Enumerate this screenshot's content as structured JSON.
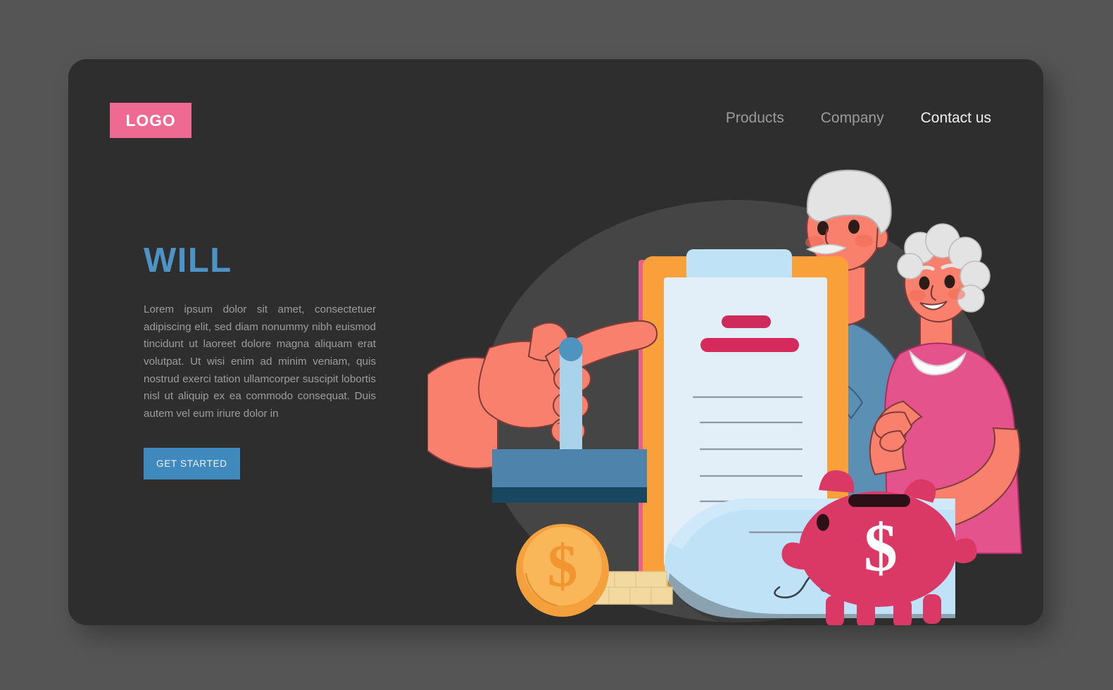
{
  "page": {
    "background_color": "#555555",
    "card_color": "#2e2e2e"
  },
  "header": {
    "logo_text": "LOGO",
    "logo_color": "#ef6a93",
    "nav_items": [
      {
        "label": "Products",
        "active": false
      },
      {
        "label": "Company",
        "active": false
      },
      {
        "label": "Contact us",
        "active": true
      }
    ]
  },
  "hero": {
    "title": "WILL",
    "title_color": "#4e93c6",
    "body": "Lorem ipsum dolor sit amet, consectetuer adipiscing elit, sed diam nonummy nibh euismod tincidunt ut laoreet dolore magna aliquam erat volutpat. Ut wisi enim ad minim veniam, quis nostrud exerci tation ullamcorper suscipit lobortis nisl ut aliquip ex ea commodo consequat. Duis autem vel eum iriure dolor in",
    "body_color": "#9d9d9d",
    "cta_label": "GET STARTED",
    "cta_color": "#4089bd"
  },
  "illustration": {
    "name": "will-signing-illustration",
    "description": "Elderly couple behind a clipboard with a will document, a hand holding a rubber stamp, a gold dollar coin with coin stack, a curled signed paper and a pink piggy bank",
    "elements": [
      {
        "name": "background-blob",
        "color": "#454545"
      },
      {
        "name": "clipboard-frame",
        "color": "#f9a03a"
      },
      {
        "name": "clipboard-edge-strip",
        "color": "#e9608f"
      },
      {
        "name": "document-paper",
        "color": "#e2eff9"
      },
      {
        "name": "document-title-bar-short",
        "color": "#ce2a5b"
      },
      {
        "name": "document-title-bar-long",
        "color": "#d42a5c"
      },
      {
        "name": "document-text-line",
        "color": "#8d98a3"
      },
      {
        "name": "curled-paper",
        "color": "#bfe2f7"
      },
      {
        "name": "curled-paper-shadow",
        "color": "#17455e"
      },
      {
        "name": "signature",
        "color": "#39424a"
      },
      {
        "name": "stamp-handle",
        "color": "#a8d3ea"
      },
      {
        "name": "stamp-knob",
        "color": "#4f93bf"
      },
      {
        "name": "stamp-body",
        "color": "#4e83ab"
      },
      {
        "name": "stamp-base",
        "color": "#17485f"
      },
      {
        "name": "skin",
        "color": "#f9806c"
      },
      {
        "name": "skin-outline",
        "color": "#7e3b38"
      },
      {
        "name": "man-shirt",
        "color": "#5c8fb4"
      },
      {
        "name": "woman-shirt",
        "color": "#e5538c"
      },
      {
        "name": "woman-collar",
        "color": "#ffffff"
      },
      {
        "name": "hair-white",
        "color": "#e3e3e3"
      },
      {
        "name": "coin-gold",
        "color": "#f4a03d"
      },
      {
        "name": "coin-gold-inner",
        "color": "#f9b75a"
      },
      {
        "name": "coin-stack",
        "color": "#f2d9a0"
      },
      {
        "name": "piggy-bank",
        "color": "#d93964"
      },
      {
        "name": "piggy-slot",
        "color": "#2b1018"
      },
      {
        "name": "piggy-dollar",
        "color": "#ffffff"
      }
    ],
    "coin_symbol": "$",
    "piggy_symbol": "$"
  }
}
